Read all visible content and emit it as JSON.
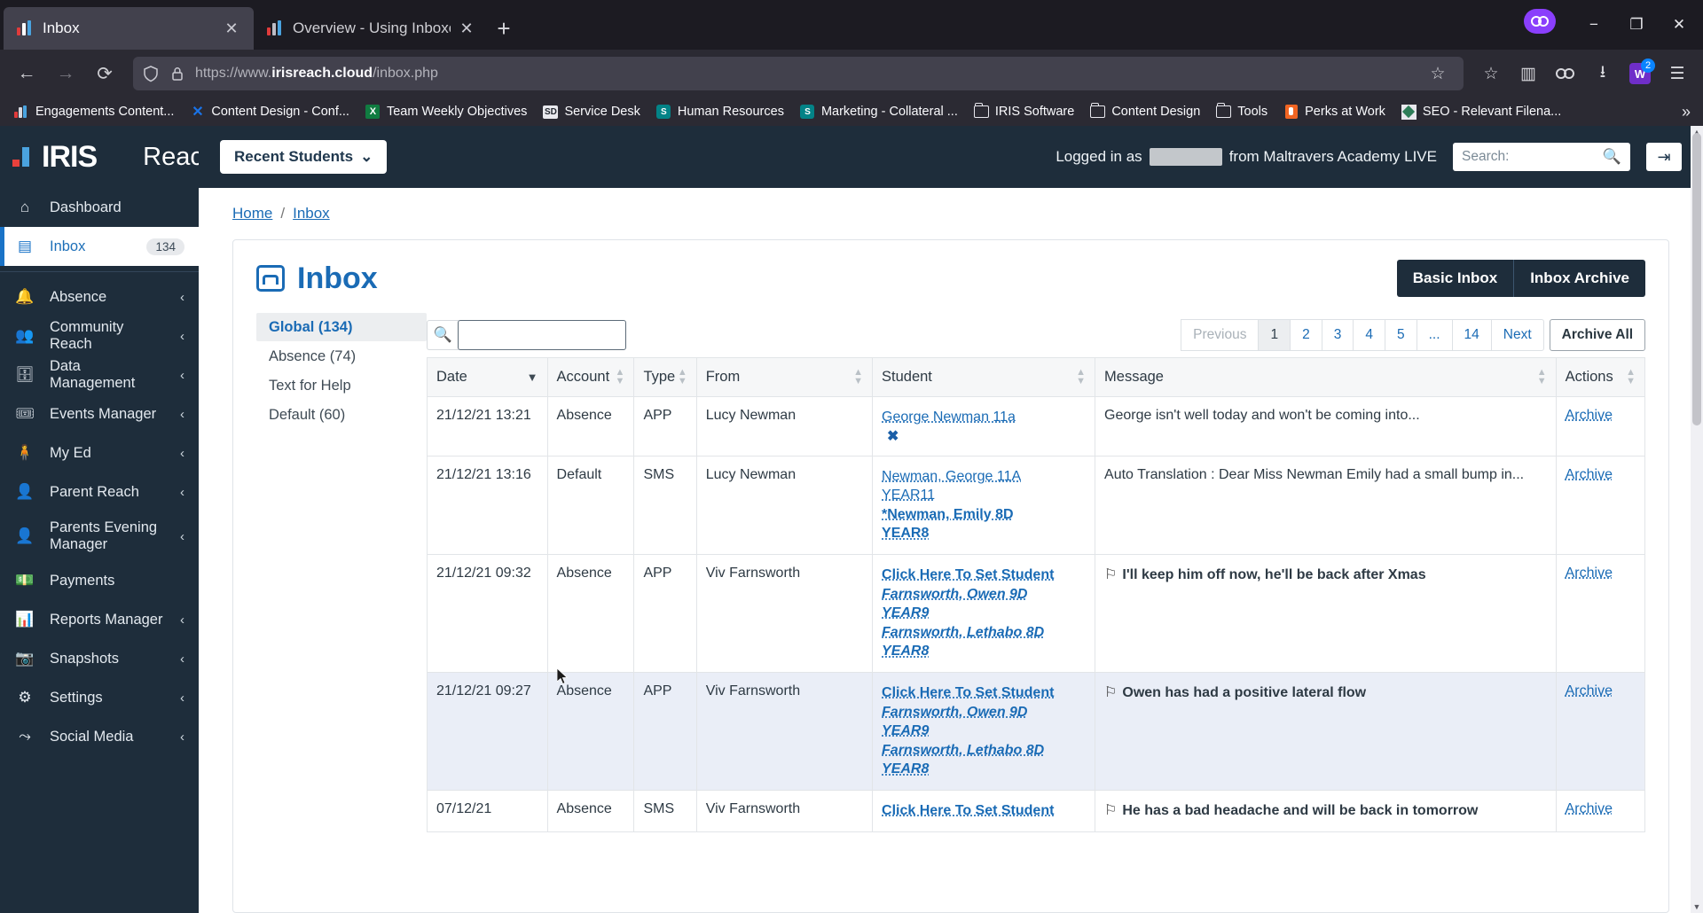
{
  "browser": {
    "tabs": [
      {
        "title": "Inbox",
        "icon": "iris-chart-icon",
        "active": true
      },
      {
        "title": "Overview - Using Inboxes – IRIS",
        "icon": "iris-chart-icon",
        "active": false
      }
    ],
    "newtab_label": "+",
    "nav": {
      "back": "←",
      "forward": "→",
      "reload": "⟳"
    },
    "url": {
      "scheme": "https://www.",
      "host": "irisreach.cloud",
      "path": "/inbox.php"
    },
    "url_icons": [
      "shield-icon",
      "lock-icon"
    ],
    "url_right_icons": [
      "bookmark-star-icon",
      "save-to-pocket-icon",
      "library-icon",
      "extension-icon",
      "downloads-icon",
      "account-icon",
      "menu-icon"
    ],
    "download_badge": "2",
    "window_controls": {
      "minimize": "−",
      "maximize": "❐",
      "close": "✕"
    },
    "bookmarks": [
      {
        "label": "Engagements Content...",
        "icon": "chart-bars-icon"
      },
      {
        "label": "Content Design - Conf...",
        "icon": "confluence-icon"
      },
      {
        "label": "Team Weekly Objectives",
        "icon": "excel-icon"
      },
      {
        "label": "Service Desk",
        "icon": "service-desk-icon"
      },
      {
        "label": "Human Resources",
        "icon": "sharepoint-icon"
      },
      {
        "label": "Marketing - Collateral ...",
        "icon": "sharepoint-icon"
      },
      {
        "label": "IRIS Software",
        "icon": "folder-icon"
      },
      {
        "label": "Content Design",
        "icon": "folder-icon"
      },
      {
        "label": "Tools",
        "icon": "folder-icon"
      },
      {
        "label": "Perks at Work",
        "icon": "perks-icon"
      },
      {
        "label": "SEO - Relevant Filena...",
        "icon": "seo-icon"
      }
    ],
    "bookmarks_overflow": "»"
  },
  "app": {
    "brand": {
      "name": "IRIS",
      "product": "Reach"
    },
    "topbar": {
      "recent_students": "Recent Students",
      "recent_students_chevron": "⌄",
      "logged_in_prefix": "Logged in as",
      "logged_in_user": "",
      "logged_in_suffix": "from Maltravers Academy LIVE",
      "search_placeholder": "Search:",
      "search_icon": "search-icon",
      "logout_icon": "logout-icon"
    },
    "sidebar": {
      "items": [
        {
          "label": "Dashboard",
          "icon": "home-icon",
          "chevron": "",
          "badge": "",
          "active": false
        },
        {
          "label": "Inbox",
          "icon": "inbox-icon",
          "chevron": "",
          "badge": "134",
          "active": true
        },
        {
          "label": "Absence",
          "icon": "bell-icon",
          "chevron": "‹",
          "badge": "",
          "active": false
        },
        {
          "label": "Community Reach",
          "icon": "people-icon",
          "chevron": "‹",
          "badge": "",
          "active": false
        },
        {
          "label": "Data Management",
          "icon": "database-icon",
          "chevron": "‹",
          "badge": "",
          "active": false
        },
        {
          "label": "Events Manager",
          "icon": "ticket-icon",
          "chevron": "‹",
          "badge": "",
          "active": false
        },
        {
          "label": "My Ed",
          "icon": "person-raised-icon",
          "chevron": "‹",
          "badge": "",
          "active": false
        },
        {
          "label": "Parent Reach",
          "icon": "user-icon",
          "chevron": "‹",
          "badge": "",
          "active": false
        },
        {
          "label": "Parents Evening Manager",
          "icon": "user-icon",
          "chevron": "‹",
          "badge": "",
          "active": false
        },
        {
          "label": "Payments",
          "icon": "banknote-icon",
          "chevron": "",
          "badge": "",
          "active": false
        },
        {
          "label": "Reports Manager",
          "icon": "bar-chart-icon",
          "chevron": "‹",
          "badge": "",
          "active": false
        },
        {
          "label": "Snapshots",
          "icon": "camera-icon",
          "chevron": "‹",
          "badge": "",
          "active": false
        },
        {
          "label": "Settings",
          "icon": "gear-icon",
          "chevron": "‹",
          "badge": "",
          "active": false
        },
        {
          "label": "Social Media",
          "icon": "share-icon",
          "chevron": "‹",
          "badge": "",
          "active": false
        }
      ]
    },
    "breadcrumb": {
      "home": "Home",
      "separator": "/",
      "current": "Inbox"
    },
    "page": {
      "title": "Inbox",
      "title_icon": "inbox-icon",
      "buttons": {
        "basic": "Basic Inbox",
        "archive": "Inbox Archive"
      }
    },
    "filters": [
      {
        "label": "Global (134)",
        "active": true
      },
      {
        "label": "Absence (74)",
        "active": false
      },
      {
        "label": "Text for Help",
        "active": false
      },
      {
        "label": "Default (60)",
        "active": false
      }
    ],
    "toolbar": {
      "search_value": "",
      "search_icon": "search-icon",
      "pagination": {
        "previous": "Previous",
        "pages": [
          "1",
          "2",
          "3",
          "4",
          "5",
          "...",
          "14"
        ],
        "active_page": "1",
        "next": "Next",
        "archive_all": "Archive All"
      }
    },
    "table": {
      "columns": [
        {
          "label": "Date",
          "sort": "desc"
        },
        {
          "label": "Account",
          "sort": "both"
        },
        {
          "label": "Type",
          "sort": "both"
        },
        {
          "label": "From",
          "sort": "both"
        },
        {
          "label": "Student",
          "sort": "both"
        },
        {
          "label": "Message",
          "sort": "both"
        },
        {
          "label": "Actions",
          "sort": "both"
        }
      ],
      "rows": [
        {
          "date": "21/12/21 13:21",
          "account": "Absence",
          "type": "APP",
          "from": "Lucy Newman",
          "students": [
            {
              "text": "George Newman 11a",
              "link": true,
              "italic": false,
              "bold": false
            }
          ],
          "student_x": "✖",
          "message": "George isn't well today and won't be coming into...",
          "flag": false,
          "bold_message": false,
          "action": "Archive",
          "highlight": false
        },
        {
          "date": "21/12/21 13:16",
          "account": "Default",
          "type": "SMS",
          "from": "Lucy Newman",
          "students": [
            {
              "text": "Newman, George 11A",
              "link": true,
              "italic": false,
              "bold": false
            },
            {
              "text": "YEAR11",
              "link": true,
              "italic": false,
              "bold": false
            },
            {
              "text": "*Newman, Emily 8D",
              "link": true,
              "italic": false,
              "bold": true
            },
            {
              "text": "YEAR8",
              "link": true,
              "italic": false,
              "bold": true
            }
          ],
          "student_x": "",
          "message": "Auto Translation : Dear Miss Newman Emily had a small bump in...",
          "flag": false,
          "bold_message": false,
          "action": "Archive",
          "highlight": false
        },
        {
          "date": "21/12/21 09:32",
          "account": "Absence",
          "type": "APP",
          "from": "Viv Farnsworth",
          "students": [
            {
              "text": "Click Here To Set Student",
              "link": true,
              "italic": false,
              "bold": true
            },
            {
              "text": "Farnsworth, Owen 9D",
              "link": true,
              "italic": true,
              "bold": true
            },
            {
              "text": "YEAR9",
              "link": true,
              "italic": true,
              "bold": true
            },
            {
              "text": "Farnsworth, Lethabo 8D",
              "link": true,
              "italic": true,
              "bold": true
            },
            {
              "text": "YEAR8",
              "link": true,
              "italic": true,
              "bold": true
            }
          ],
          "student_x": "",
          "message": "I'll keep him off now, he'll be back after Xmas",
          "flag": true,
          "bold_message": true,
          "action": "Archive",
          "highlight": false
        },
        {
          "date": "21/12/21 09:27",
          "account": "Absence",
          "type": "APP",
          "from": "Viv Farnsworth",
          "students": [
            {
              "text": "Click Here To Set Student",
              "link": true,
              "italic": false,
              "bold": true
            },
            {
              "text": "Farnsworth, Owen 9D",
              "link": true,
              "italic": true,
              "bold": true
            },
            {
              "text": "YEAR9",
              "link": true,
              "italic": true,
              "bold": true
            },
            {
              "text": "Farnsworth, Lethabo 8D",
              "link": true,
              "italic": true,
              "bold": true
            },
            {
              "text": "YEAR8",
              "link": true,
              "italic": true,
              "bold": true
            }
          ],
          "student_x": "",
          "message": "Owen has had a positive lateral flow",
          "flag": true,
          "bold_message": true,
          "action": "Archive",
          "highlight": true
        },
        {
          "date": "07/12/21",
          "account": "Absence",
          "type": "SMS",
          "from": "Viv Farnsworth",
          "students": [
            {
              "text": "Click Here To Set Student",
              "link": true,
              "italic": false,
              "bold": true
            }
          ],
          "student_x": "",
          "message": "He has a bad headache and will be back in tomorrow",
          "flag": true,
          "bold_message": true,
          "action": "Archive",
          "highlight": false
        }
      ]
    }
  }
}
